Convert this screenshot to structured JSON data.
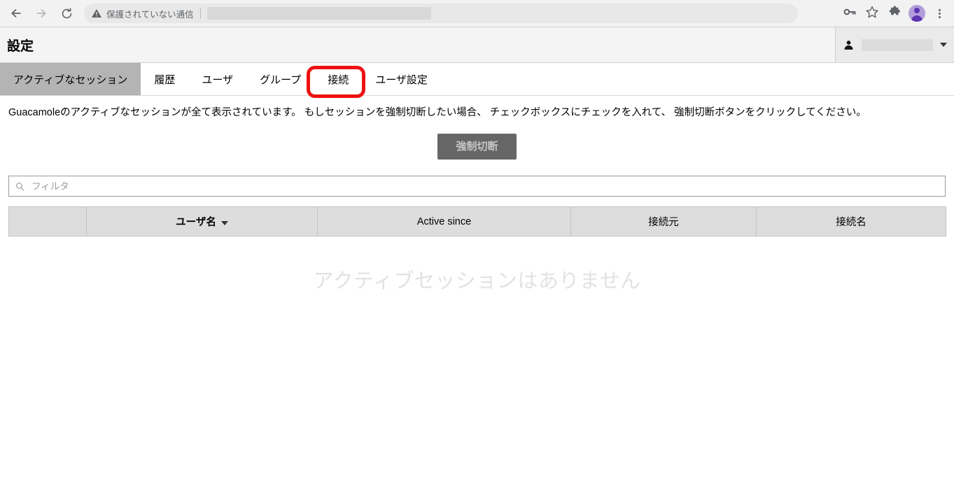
{
  "browser": {
    "back_icon": "arrow-left-icon",
    "forward_icon": "arrow-right-icon",
    "reload_icon": "reload-icon",
    "security_label": "保護されていない通信",
    "url_value": "",
    "url_placeholder": "",
    "key_icon": "key-icon",
    "bookmark_icon": "star-icon",
    "extensions_icon": "puzzle-icon",
    "profile_icon": "avatar-icon",
    "menu_icon": "kebab-menu-icon"
  },
  "header": {
    "title": "設定",
    "user_icon": "person-icon",
    "user_name": "",
    "dropdown_icon": "chevron-down-icon"
  },
  "tabs": [
    {
      "label": "アクティブなセッション",
      "active": true,
      "annotated": false
    },
    {
      "label": "履歴",
      "active": false,
      "annotated": false
    },
    {
      "label": "ユーザ",
      "active": false,
      "annotated": false
    },
    {
      "label": "グループ",
      "active": false,
      "annotated": false
    },
    {
      "label": "接続",
      "active": false,
      "annotated": true
    },
    {
      "label": "ユーザ設定",
      "active": false,
      "annotated": false
    }
  ],
  "main": {
    "description": "Guacamoleのアクティブなセッションが全て表示されています。 もしセッションを強制切断したい場合、 チェックボックスにチェックを入れて、 強制切断ボタンをクリックしてください。",
    "disconnect_button": "強制切断",
    "disconnect_button_disabled": true,
    "filter_placeholder": "フィルタ",
    "filter_value": "",
    "search_icon": "search-icon",
    "table": {
      "columns": [
        {
          "label": "",
          "sorted": false
        },
        {
          "label": "ユーザ名",
          "sorted": true
        },
        {
          "label": "Active since",
          "sorted": false
        },
        {
          "label": "接続元",
          "sorted": false
        },
        {
          "label": "接続名",
          "sorted": false
        }
      ],
      "rows": [],
      "empty_message": "アクティブセッションはありません"
    }
  },
  "colors": {
    "annotation": "#ee1111",
    "active_tab_bg": "#b4b4b4",
    "disabled_button_bg": "#666666",
    "table_header_bg": "#dddddd",
    "empty_text": "#e2e2e2"
  }
}
